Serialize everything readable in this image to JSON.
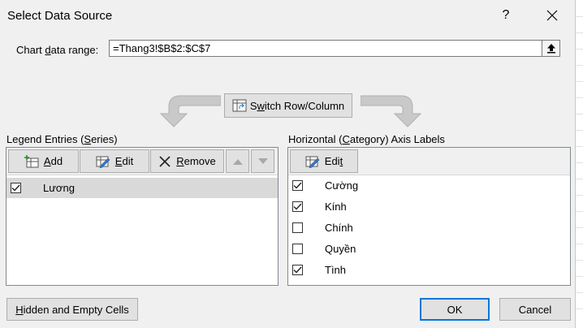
{
  "window": {
    "title": "Select Data Source",
    "help": "?"
  },
  "range": {
    "label_pre": "Chart ",
    "label_u": "d",
    "label_post": "ata range:",
    "value": "=Thang3!$B$2:$C$7"
  },
  "switch": {
    "label_pre": "S",
    "label_u": "w",
    "label_post": "itch Row/Column"
  },
  "legend": {
    "title_pre": "Legend Entries (",
    "title_u": "S",
    "title_post": "eries)",
    "add_pre": "",
    "add_u": "A",
    "add_post": "dd",
    "edit_pre": "",
    "edit_u": "E",
    "edit_post": "dit",
    "remove_pre": "",
    "remove_u": "R",
    "remove_post": "emove",
    "items": [
      {
        "label": "Lương",
        "checked": true
      }
    ]
  },
  "axis": {
    "title_pre": "Horizontal (",
    "title_u": "C",
    "title_post": "ategory) Axis Labels",
    "edit_pre": "Edi",
    "edit_u": "t",
    "edit_post": "",
    "items": [
      {
        "label": "Cường",
        "checked": true
      },
      {
        "label": "Kính",
        "checked": true
      },
      {
        "label": "Chính",
        "checked": false
      },
      {
        "label": "Quyền",
        "checked": false
      },
      {
        "label": "Tình",
        "checked": true
      }
    ]
  },
  "footer": {
    "hidden_pre": "",
    "hidden_u": "H",
    "hidden_post": "idden and Empty Cells",
    "ok": "OK",
    "cancel": "Cancel"
  },
  "colors": {
    "accent": "#0078d7",
    "panel_border": "#828790",
    "selected_row": "#d9d9d9"
  }
}
